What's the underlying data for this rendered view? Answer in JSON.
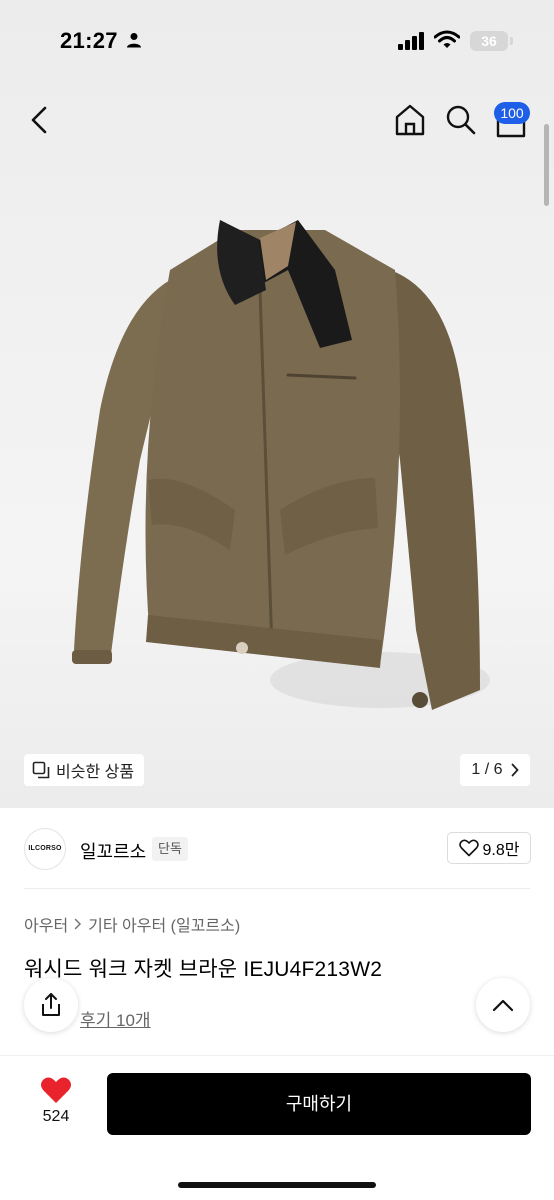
{
  "status_bar": {
    "time": "21:27",
    "battery": "36"
  },
  "nav": {
    "cart_count": "100"
  },
  "gallery": {
    "similar_label": "비슷한 상품",
    "page_indicator": "1 / 6"
  },
  "brand": {
    "logo_text": "ILCORSO",
    "name": "일꼬르소",
    "tag": "단독",
    "likes": "9.8만"
  },
  "breadcrumb": {
    "category": "아우터",
    "subcategory": "기타 아우터 (일꼬르소)"
  },
  "product": {
    "title": "워시드 워크 자켓 브라운 IEJU4F213W2",
    "reviews": "후기 10개"
  },
  "bottom": {
    "like_count": "524",
    "buy_label": "구매하기"
  },
  "colors": {
    "accent": "#1f5ee6",
    "heart": "#e8232b",
    "jacket": "#7a6a4f",
    "collar": "#1a1a1a"
  }
}
